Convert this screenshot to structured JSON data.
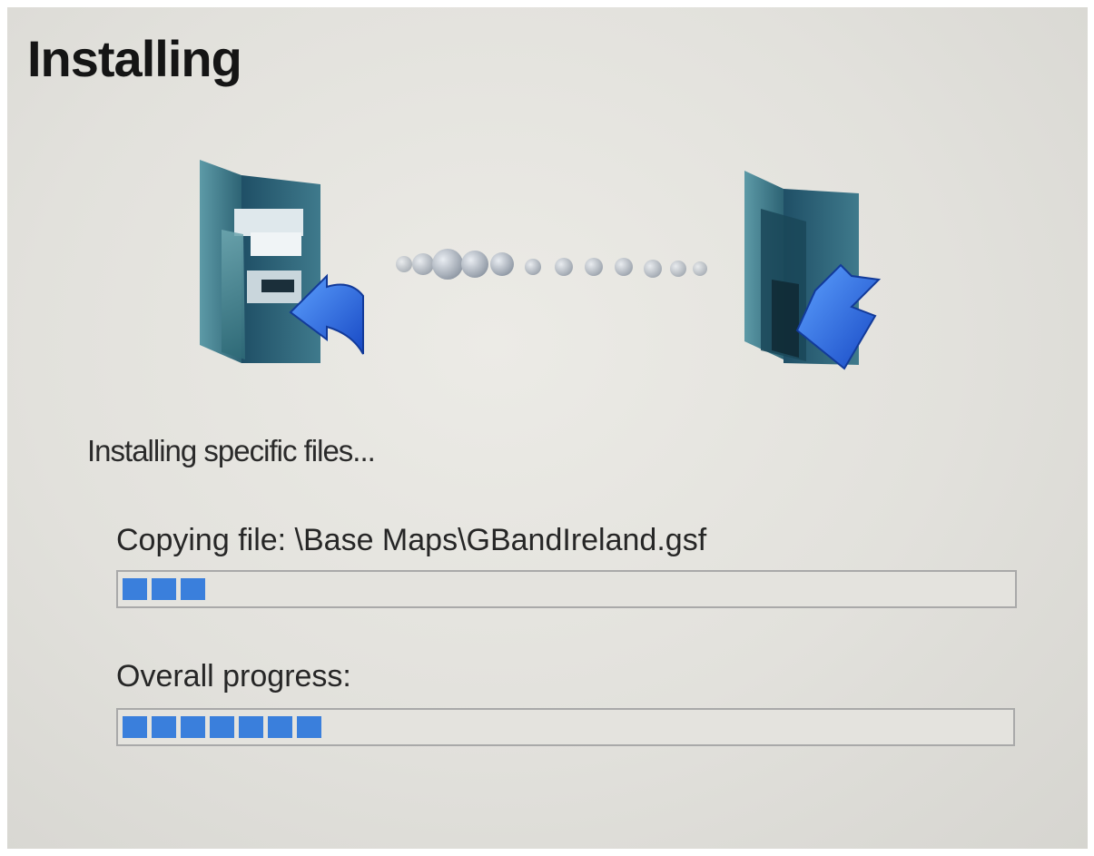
{
  "title": "Installing",
  "status_text": "Installing specific files...",
  "current_file": {
    "label": "Copying file: \\Base Maps\\GBandIreland.gsf",
    "progress_percent": 9
  },
  "overall": {
    "label": "Overall progress:",
    "progress_percent": 24
  },
  "icons": {
    "source": "source-folder-icon",
    "destination": "destination-folder-icon",
    "transfer": "transfer-dots-icon"
  },
  "colors": {
    "progress_fill": "#3a7fdc",
    "background": "#e4e3de"
  }
}
